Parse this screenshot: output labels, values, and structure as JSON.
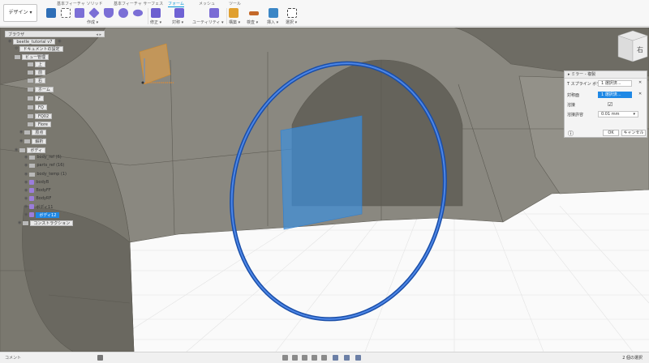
{
  "toolbar": {
    "workspace": "デザイン ▾",
    "tabs": [
      "基本フィーチャ ソリッド",
      "基本フィーチャ サーフェス",
      "フォーム",
      "メッシュ",
      "ツール"
    ],
    "active_tab_index": 2,
    "groups": [
      "作成 ▾",
      "修正 ▾",
      "対称 ▾",
      "ユーティリティ ▾",
      "構築 ▾",
      "検査 ▾",
      "挿入 ▾",
      "選択 ▾"
    ],
    "accent": "#0696d7"
  },
  "browser": {
    "title": "ブラウザ",
    "items": [
      {
        "label": "beetle_tutorial v7"
      },
      {
        "label": "ドキュメントの設定"
      },
      {
        "label": "ビュー管理"
      },
      {
        "label": "上"
      },
      {
        "label": "前"
      },
      {
        "label": "右"
      },
      {
        "label": "ホーム"
      },
      {
        "label": "F"
      },
      {
        "label": "FQ"
      },
      {
        "label": "FQ02"
      },
      {
        "label": "Fiore"
      },
      {
        "label": "原点"
      },
      {
        "label": "解析"
      },
      {
        "label": "ボディ"
      },
      {
        "label": "body_ref (6)"
      },
      {
        "label": "parts_ref (16)"
      },
      {
        "label": "body_temp (1)"
      },
      {
        "label": "bodyB"
      },
      {
        "label": "BodyFF"
      },
      {
        "label": "BodyRF"
      },
      {
        "label": "ボディ11"
      },
      {
        "label": "ボディ12"
      },
      {
        "label": "コンストラクション"
      }
    ]
  },
  "dialog": {
    "title": "ミラー - 複製",
    "rows": [
      {
        "label": "T スプライン ボディ",
        "value": "1 選択済..."
      },
      {
        "label": "対称面",
        "value": "1 選択済..."
      },
      {
        "label": "溶接",
        "value": "☑"
      },
      {
        "label": "溶接許容",
        "value": "0.01 mm"
      }
    ],
    "ok": "OK",
    "cancel": "キャンセル",
    "info_icon": "info-icon"
  },
  "viewcube": {
    "label": "右"
  },
  "bottom": {
    "comment": "コメント",
    "status": "2 個の選択"
  }
}
